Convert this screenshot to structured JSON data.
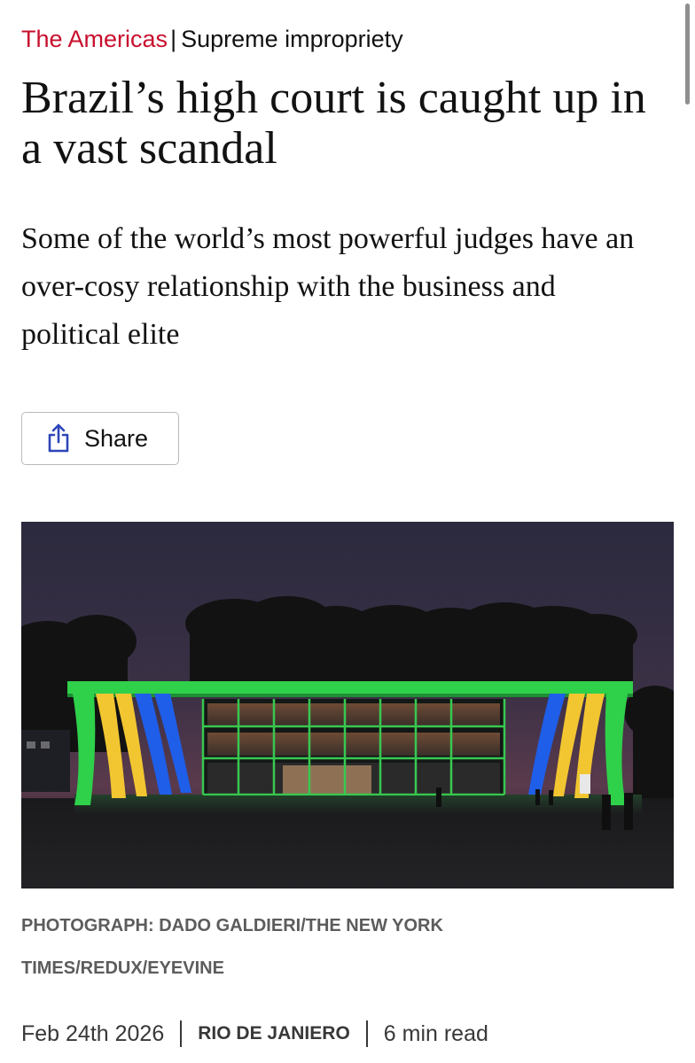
{
  "rubric": {
    "section": "The Americas",
    "flytitle": "Supreme impropriety"
  },
  "headline": "Brazil’s high court is caught up in a vast scandal",
  "standfirst": "Some of the world’s most powerful judges have an over-cosy relationship with the business and political elite",
  "share": {
    "label": "Share",
    "icon": "share-icon"
  },
  "image": {
    "description": "supreme-court-building-photo"
  },
  "caption": "PHOTOGRAPH: DADO GALDIERI/THE NEW YORK TIMES/REDUX/EYEVINE",
  "meta": {
    "date": "Feb 24th 2026",
    "location": "RIO DE JANIERO",
    "read_time": "6 min read"
  },
  "colors": {
    "accent": "#c8102e",
    "share_icon": "#2e45b8",
    "building_green": "#2fd04a",
    "brazil_yellow": "#f2c631",
    "brazil_blue": "#1f5ee8"
  }
}
